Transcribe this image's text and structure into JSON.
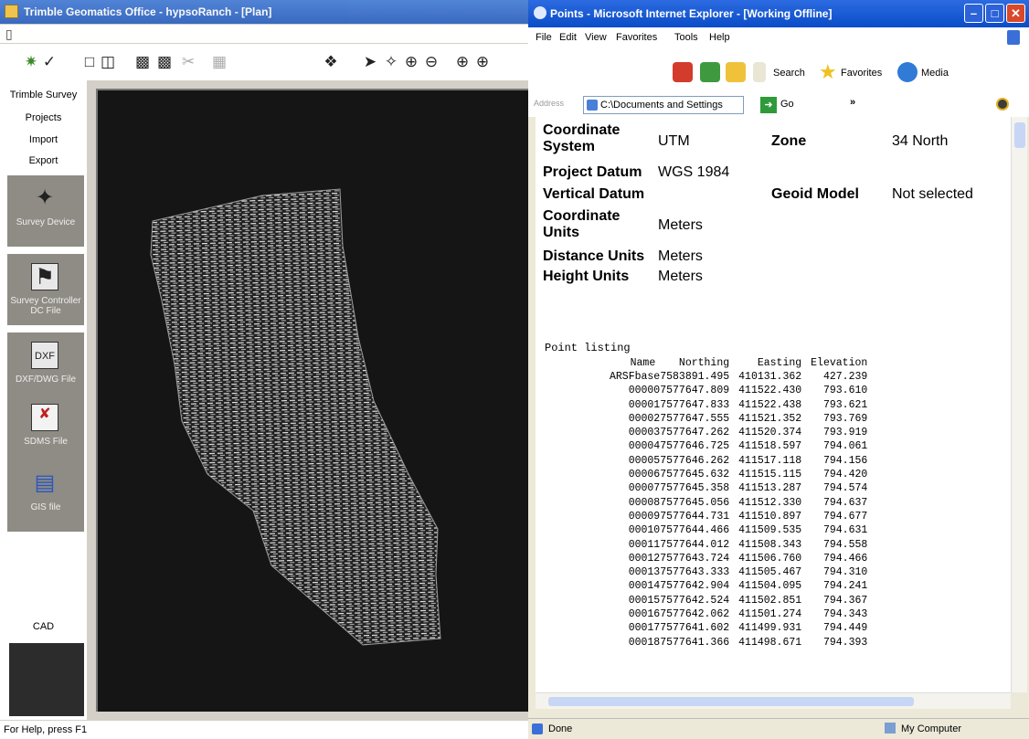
{
  "tgo": {
    "title": "Trimble Geomatics Office - hypsoRanch - [Plan]",
    "sidebar": {
      "trimble_survey": "Trimble Survey",
      "projects": "Projects",
      "import": "Import",
      "export": "Export",
      "tiles": [
        {
          "label": "Survey Device",
          "icon": "survey-device-icon"
        },
        {
          "label": "Survey Controller DC File",
          "icon": "survey-controller-icon"
        },
        {
          "label": "DXF/DWG File",
          "icon": "dxf-dwg-icon"
        },
        {
          "label": "SDMS File",
          "icon": "sdms-file-icon"
        },
        {
          "label": "GIS file",
          "icon": "gis-icon"
        }
      ],
      "cad": "CAD"
    },
    "status": "For Help, press F1"
  },
  "ie": {
    "title": "Points - Microsoft Internet Explorer - [Working Offline]",
    "menu": [
      "File",
      "Edit",
      "View",
      "Favorites",
      "Tools",
      "Help"
    ],
    "toolbar": {
      "search": "Search",
      "favorites": "Favorites",
      "media": "Media",
      "go": "Go"
    },
    "address_label": "Address",
    "address_value": "C:\\Documents and Settings",
    "status_left": "Done",
    "status_right": "My Computer"
  },
  "properties": {
    "coord_system_label": "Coordinate System",
    "coord_system_value": "UTM",
    "zone_label": "Zone",
    "zone_value": "34 North",
    "project_datum_label": "Project Datum",
    "project_datum_value": "WGS 1984",
    "vertical_datum_label": "Vertical Datum",
    "geoid_model_label": "Geoid Model",
    "geoid_model_value": "Not selected",
    "coord_units_label": "Coordinate Units",
    "coord_units_value": "Meters",
    "distance_units_label": "Distance Units",
    "distance_units_value": "Meters",
    "height_units_label": "Height Units",
    "height_units_value": "Meters"
  },
  "listing": {
    "title": "Point listing",
    "columns": [
      "Name",
      "Northing",
      "Easting",
      "Elevation"
    ],
    "rows": [
      [
        "ARSFbase",
        "7583891.495",
        "410131.362",
        "427.239"
      ],
      [
        "00000",
        "7577647.809",
        "411522.430",
        "793.610"
      ],
      [
        "00001",
        "7577647.833",
        "411522.438",
        "793.621"
      ],
      [
        "00002",
        "7577647.555",
        "411521.352",
        "793.769"
      ],
      [
        "00003",
        "7577647.262",
        "411520.374",
        "793.919"
      ],
      [
        "00004",
        "7577646.725",
        "411518.597",
        "794.061"
      ],
      [
        "00005",
        "7577646.262",
        "411517.118",
        "794.156"
      ],
      [
        "00006",
        "7577645.632",
        "411515.115",
        "794.420"
      ],
      [
        "00007",
        "7577645.358",
        "411513.287",
        "794.574"
      ],
      [
        "00008",
        "7577645.056",
        "411512.330",
        "794.637"
      ],
      [
        "00009",
        "7577644.731",
        "411510.897",
        "794.677"
      ],
      [
        "00010",
        "7577644.466",
        "411509.535",
        "794.631"
      ],
      [
        "00011",
        "7577644.012",
        "411508.343",
        "794.558"
      ],
      [
        "00012",
        "7577643.724",
        "411506.760",
        "794.466"
      ],
      [
        "00013",
        "7577643.333",
        "411505.467",
        "794.310"
      ],
      [
        "00014",
        "7577642.904",
        "411504.095",
        "794.241"
      ],
      [
        "00015",
        "7577642.524",
        "411502.851",
        "794.367"
      ],
      [
        "00016",
        "7577642.062",
        "411501.274",
        "794.343"
      ],
      [
        "00017",
        "7577641.602",
        "411499.931",
        "794.449"
      ],
      [
        "00018",
        "7577641.366",
        "411498.671",
        "794.393"
      ]
    ]
  }
}
